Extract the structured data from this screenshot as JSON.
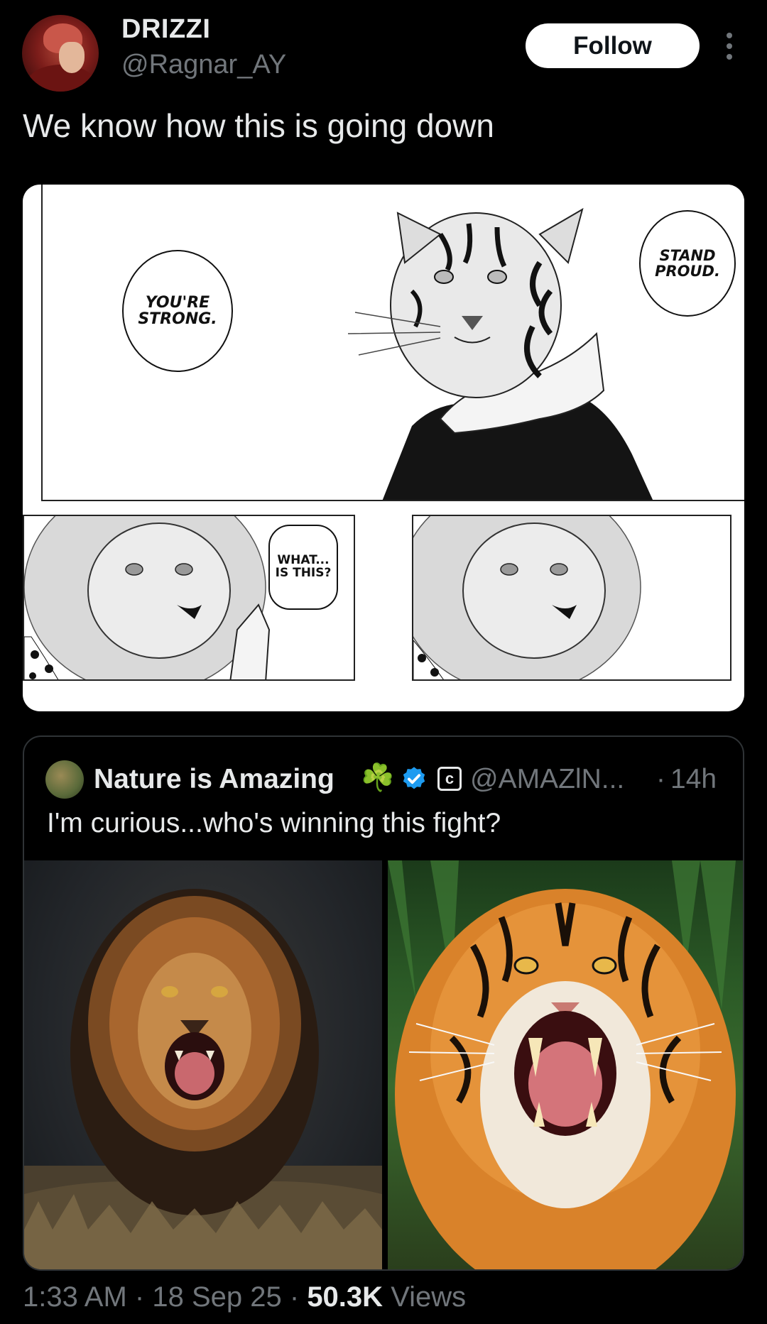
{
  "author": {
    "display_name": "DRIZZI",
    "handle": "@Ragnar_AY",
    "follow_label": "Follow"
  },
  "tweet": {
    "text": "We know how this is going down"
  },
  "manga": {
    "bubbles": {
      "youre_strong": "YOU'RE\nSTRONG.",
      "stand_proud": "STAND\nPROUD.",
      "what_is_this": "WHAT...\nIS THIS?"
    }
  },
  "quote": {
    "display_name": "Nature is Amazing",
    "clover": "☘️",
    "handle": "@AMAZlN...",
    "separator": "·",
    "time": "14h",
    "text": "I'm curious...who's winning this fight?"
  },
  "footer": {
    "time": "1:33 AM",
    "sep1": "·",
    "date": "18 Sep 25",
    "sep2": "·",
    "views_count": "50.3K",
    "views_label": "Views"
  },
  "colors": {
    "background": "#000000",
    "text_primary": "#e7e9ea",
    "text_secondary": "#71767b",
    "verified_blue": "#1d9bf0",
    "border": "#2f3336"
  },
  "icons": {
    "more": "more-vertical-icon",
    "verified": "verified-badge-icon",
    "clover": "clover-icon",
    "c_badge": "copyright-badge-icon"
  }
}
